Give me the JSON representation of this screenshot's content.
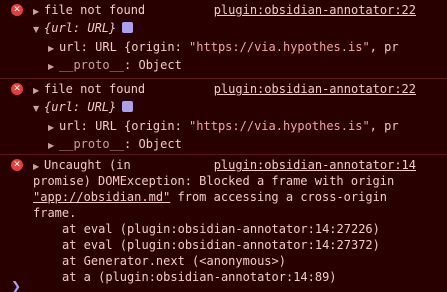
{
  "entries": [
    {
      "message": "file not found",
      "source": "plugin:obsidian-annotator:22",
      "object_label": "{url: URL}",
      "url_line_key": "url: URL {origin: ",
      "url_line_value": "\"https://via.hypothes.is\"",
      "url_line_rest": ", pr",
      "proto_label": "__proto__",
      "proto_value": ": Object"
    },
    {
      "message": "file not found",
      "source": "plugin:obsidian-annotator:22",
      "object_label": "{url: URL}",
      "url_line_key": "url: URL {origin: ",
      "url_line_value": "\"https://via.hypothes.is\"",
      "url_line_rest": ", pr",
      "proto_label": "__proto__",
      "proto_value": ": Object"
    }
  ],
  "uncaught": {
    "line1": "Uncaught (in",
    "source": "plugin:obsidian-annotator:14",
    "line2": "promise) DOMException: Blocked a frame with origin",
    "link": "\"app://obsidian.md\"",
    "line3_rest": " from accessing a cross-origin",
    "line4": "frame.",
    "stack": [
      "at eval (plugin:obsidian-annotator:14:27226)",
      "at eval (plugin:obsidian-annotator:14:27372)",
      "at Generator.next (<anonymous>)",
      "at a (plugin:obsidian-annotator:14:89)"
    ]
  },
  "icons": {
    "error": "error-icon",
    "expand": "triangle-expand-icon",
    "collapse": "triangle-collapse-icon",
    "info": "info-icon",
    "prompt": "chevron-right-icon"
  },
  "colors": {
    "background": "#290000",
    "text": "#f6c7c7",
    "error_icon": "#e63d3d",
    "info_box": "#a9a0ee"
  }
}
